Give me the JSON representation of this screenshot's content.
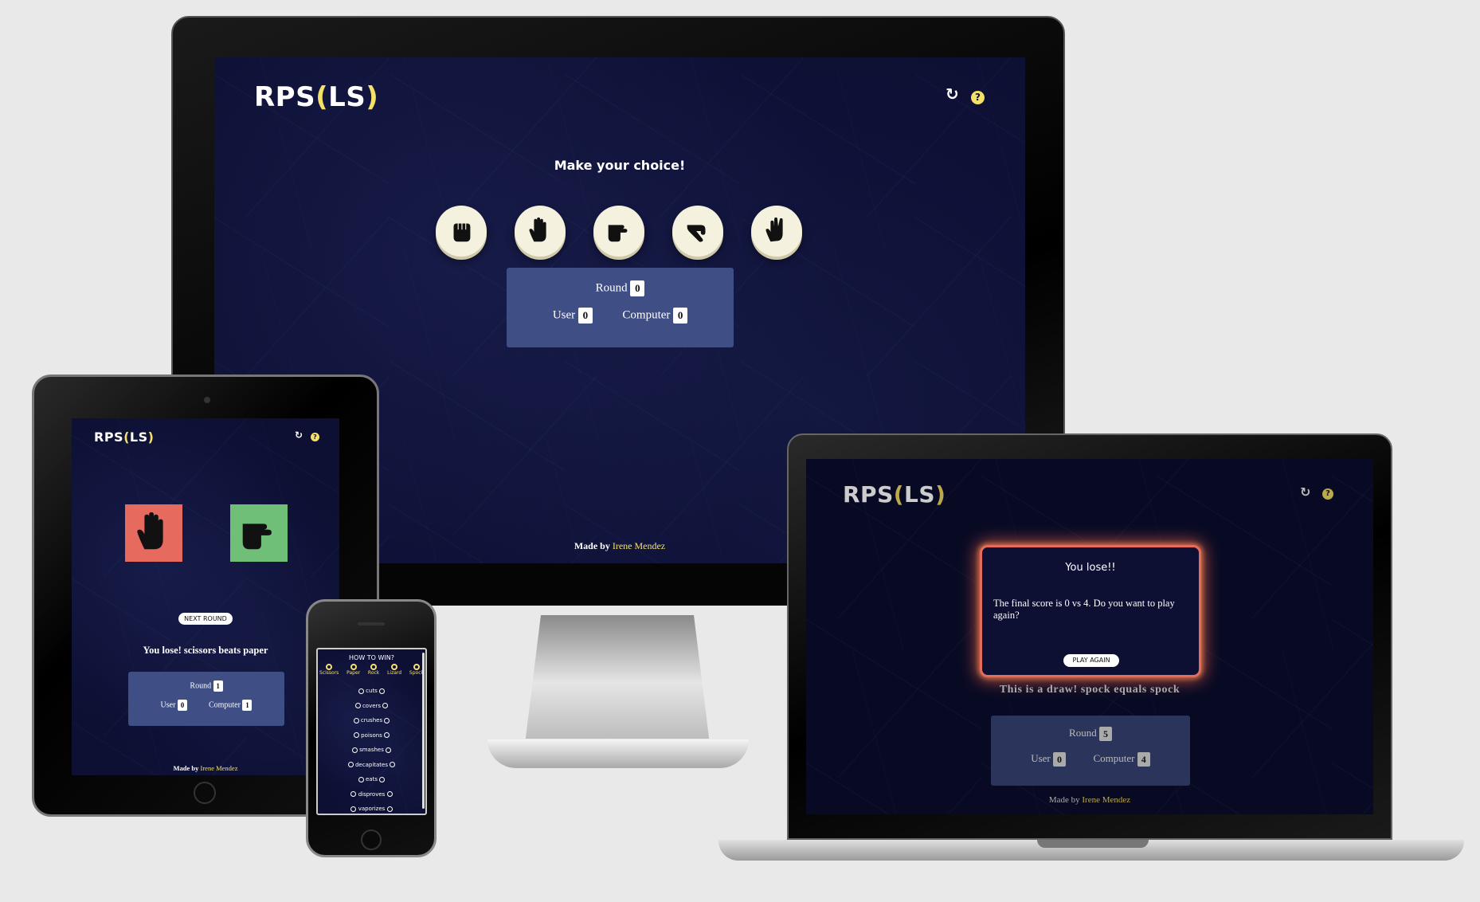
{
  "brand": {
    "logo_main": "RPS",
    "logo_open": "(",
    "logo_mid": "LS",
    "logo_close": ")"
  },
  "colors": {
    "background": "#0d0f33",
    "accent": "#f3e16a",
    "card": "#3f4f86",
    "lose": "#e76a5f",
    "win": "#6fbf78"
  },
  "header_icons": {
    "refresh": "refresh-icon",
    "help": "help-icon",
    "refresh_glyph": "↻",
    "help_glyph": "?"
  },
  "desktop": {
    "prompt": "Make your choice!",
    "choices": [
      {
        "name": "Rock",
        "icon": "rock-hand-icon"
      },
      {
        "name": "Paper",
        "icon": "paper-hand-icon"
      },
      {
        "name": "Scissors",
        "icon": "scissors-hand-icon"
      },
      {
        "name": "Lizard",
        "icon": "lizard-hand-icon"
      },
      {
        "name": "Spock",
        "icon": "spock-hand-icon"
      }
    ],
    "score": {
      "round_label": "Round",
      "round": "0",
      "user_label": "User",
      "user": "0",
      "computer_label": "Computer",
      "computer": "0"
    },
    "footer": {
      "made_by": "Made by",
      "author": "Irene Mendez"
    }
  },
  "tablet": {
    "next_round": "NEXT ROUND",
    "result": "You lose! scissors beats paper",
    "score": {
      "round_label": "Round",
      "round": "1",
      "user_label": "User",
      "user": "0",
      "computer_label": "Computer",
      "computer": "1"
    },
    "footer": {
      "made_by": "Made by",
      "author": "Irene Mendez"
    }
  },
  "phone": {
    "title": "HOW TO WIN?",
    "legend": [
      "Scissors",
      "Paper",
      "Rock",
      "Lizard",
      "Spock"
    ],
    "rules": [
      "cuts",
      "covers",
      "crushes",
      "poisons",
      "smashes",
      "decapitates",
      "eats",
      "disproves",
      "vaporizes"
    ]
  },
  "laptop": {
    "modal_title": "You lose!!",
    "modal_text": "The final score is 0 vs 4. Do you want to play again?",
    "play_again": "PLAY AGAIN",
    "result": "This is a draw! spock equals spock",
    "score": {
      "round_label": "Round",
      "round": "5",
      "user_label": "User",
      "user": "0",
      "computer_label": "Computer",
      "computer": "4"
    },
    "footer": {
      "made_by": "Made by",
      "author": "Irene Mendez"
    }
  }
}
